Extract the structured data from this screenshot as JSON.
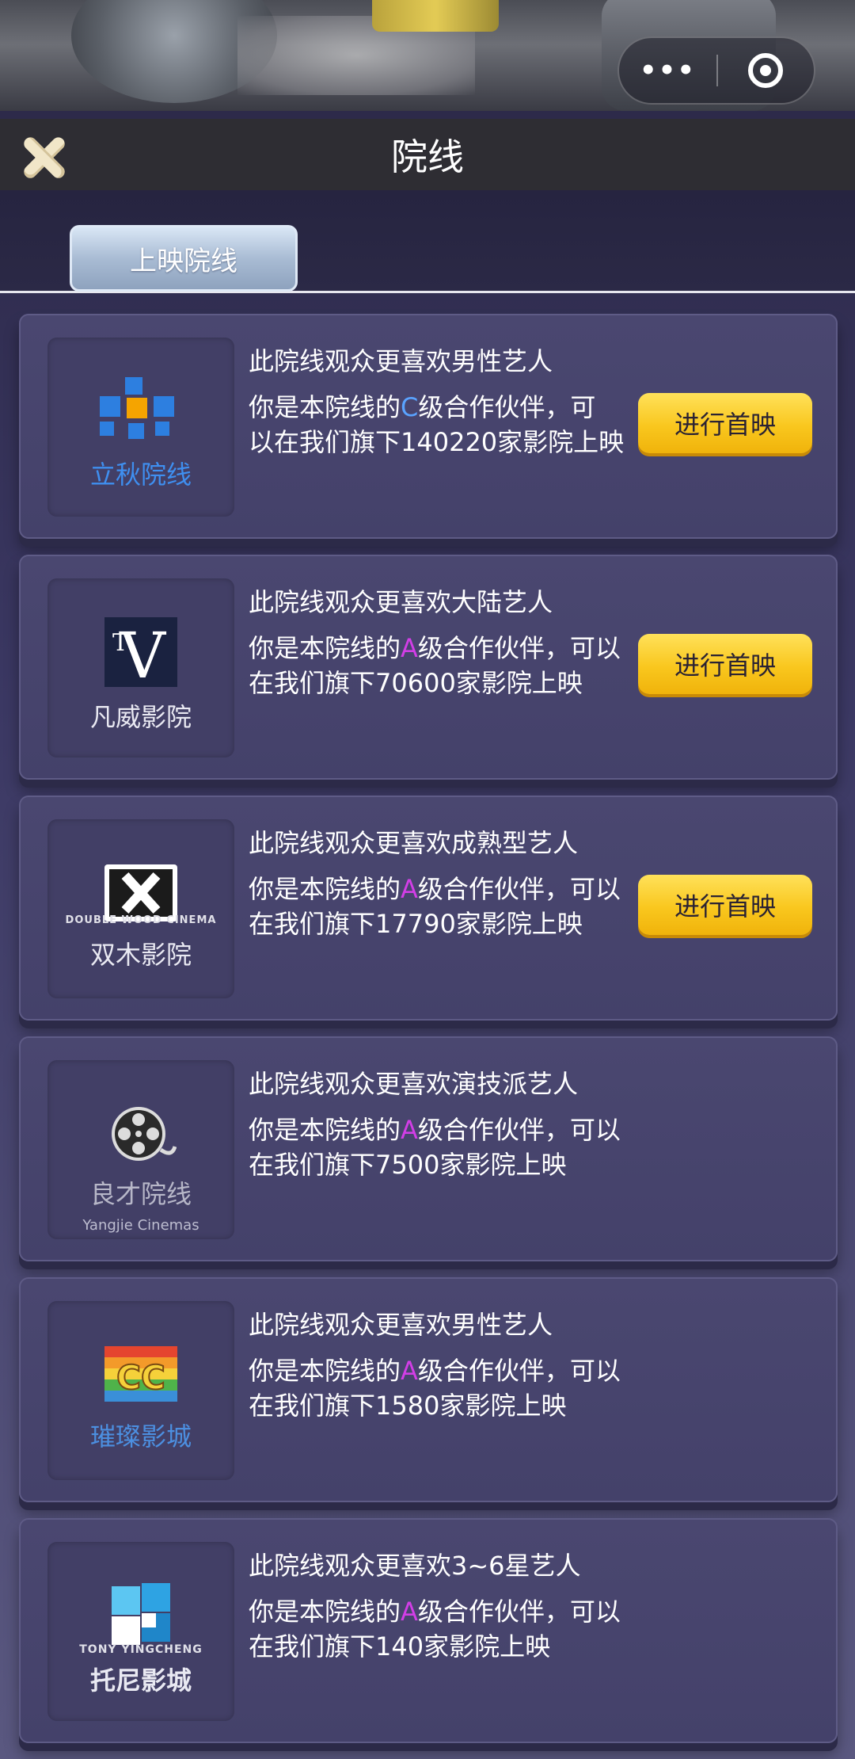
{
  "header": {
    "title": "院线",
    "capsule": {
      "more_icon": "more-dots-icon",
      "close_icon": "target-circle-icon"
    }
  },
  "tabs": [
    {
      "label": "上映院线"
    }
  ],
  "cinemas": [
    {
      "logo_name": "立秋院线",
      "logo_sub": "",
      "preference": "此院线观众更喜欢男性艺人",
      "desc_prefix": "你是本院线的",
      "grade": "C",
      "desc_suffix_line1": "级合作伙伴，可",
      "desc_line2": "以在我们旗下140220家影院上映",
      "button": "进行首映"
    },
    {
      "logo_name": "凡威影院",
      "preference": "此院线观众更喜欢大陆艺人",
      "desc_prefix": "你是本院线的",
      "grade": "A",
      "desc_suffix_line1": "级合作伙伴，可以",
      "desc_line2": "在我们旗下70600家影院上映",
      "button": "进行首映"
    },
    {
      "logo_name": "双木影院",
      "logo_sub": "DOUBLE WOOD CINEMA",
      "preference": "此院线观众更喜欢成熟型艺人",
      "desc_prefix": "你是本院线的",
      "grade": "A",
      "desc_suffix_line1": "级合作伙伴，可以",
      "desc_line2": "在我们旗下17790家影院上映",
      "button": "进行首映"
    },
    {
      "logo_name": "良才院线",
      "logo_sub2": "Yangjie Cinemas",
      "preference": "此院线观众更喜欢演技派艺人",
      "desc_prefix": "你是本院线的",
      "grade": "A",
      "desc_suffix_line1": "级合作伙伴，可以",
      "desc_line2": "在我们旗下7500家影院上映"
    },
    {
      "logo_name": "璀璨影城",
      "logo_mark_text": "CC",
      "preference": "此院线观众更喜欢男性艺人",
      "desc_prefix": "你是本院线的",
      "grade": "A",
      "desc_suffix_line1": "级合作伙伴，可以",
      "desc_line2": "在我们旗下1580家影院上映"
    },
    {
      "logo_name": "托尼影城",
      "logo_sub": "TONY YINGCHENG",
      "preference": "此院线观众更喜欢3~6星艺人",
      "desc_prefix": "你是本院线的",
      "grade": "A",
      "desc_suffix_line1": "级合作伙伴，可以",
      "desc_line2": "在我们旗下140家影院上映"
    }
  ],
  "colors": {
    "grade_c": "#5aa3ff",
    "grade_a": "#d23ee6",
    "button": "#f9c71e"
  }
}
